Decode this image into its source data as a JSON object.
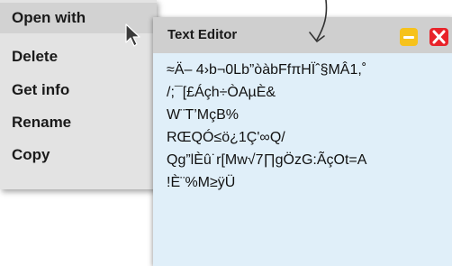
{
  "context_menu": {
    "items": [
      {
        "label": "Open with",
        "highlighted": true
      },
      {
        "label": "Delete",
        "highlighted": false
      },
      {
        "label": "Get info",
        "highlighted": false
      },
      {
        "label": "Rename",
        "highlighted": false
      },
      {
        "label": "Copy",
        "highlighted": false
      }
    ]
  },
  "editor": {
    "title": "Text Editor",
    "lines": [
      "≈Ä– 4›b¬0Lb”òàbFfπHÏˆ§MÂ1,˚",
      "/;¯[£Áçh÷ÒAµÈ&",
      "W¨T’MçB%",
      "RŒQÓ≤ö¿1Ç'∞Q/",
      "Qg”lÈû˙r[Mw√7∏gÖzG:ÃçOt=A",
      "!È¨%M≥ÿÜ"
    ]
  },
  "colors": {
    "menu_background": "#e3e3e3",
    "menu_highlight": "#d2d2d2",
    "title_bar": "#cfcfcf",
    "editor_background": "#e0eff9",
    "minimize_button": "#f6c21c",
    "close_button": "#e8232a"
  },
  "icons": {
    "pointer": "mouse-pointer-icon",
    "minimize": "minimize-icon",
    "close": "close-icon",
    "annotation": "curved-arrow-icon"
  }
}
